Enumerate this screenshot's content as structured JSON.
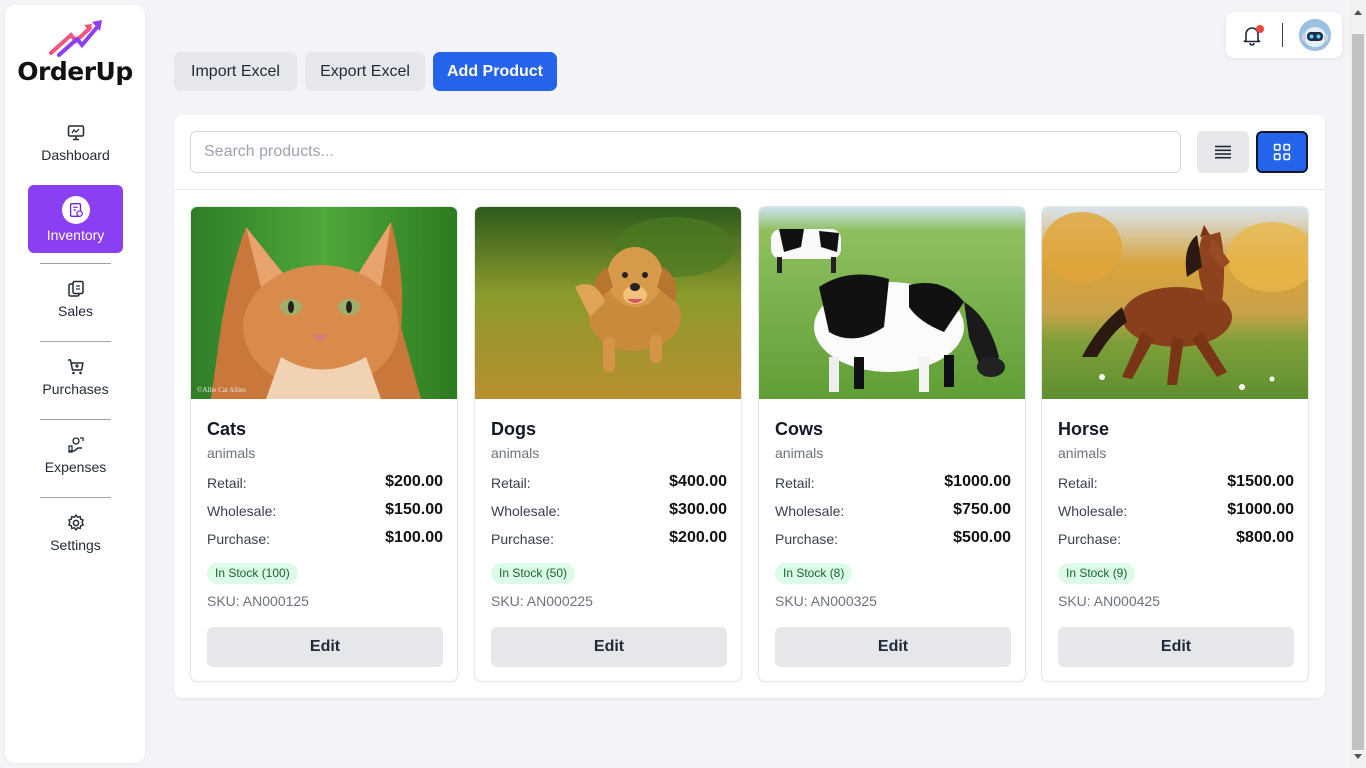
{
  "brand": {
    "name": "OrderUp"
  },
  "sidebar": {
    "items": [
      {
        "label": "Dashboard",
        "icon": "monitor-icon"
      },
      {
        "label": "Inventory",
        "icon": "inventory-icon",
        "active": true
      },
      {
        "label": "Sales",
        "icon": "sales-icon"
      },
      {
        "label": "Purchases",
        "icon": "cart-icon"
      },
      {
        "label": "Expenses",
        "icon": "expenses-icon"
      },
      {
        "label": "Settings",
        "icon": "gear-icon"
      }
    ]
  },
  "header": {
    "notification_icon": "bell-icon",
    "avatar_icon": "robot-avatar"
  },
  "toolbar": {
    "import_label": "Import Excel",
    "export_label": "Export Excel",
    "add_label": "Add Product"
  },
  "search": {
    "placeholder": "Search products...",
    "value": ""
  },
  "view_toggle": {
    "list_icon": "list-icon",
    "grid_icon": "grid-icon",
    "active": "grid"
  },
  "labels": {
    "retail": "Retail:",
    "wholesale": "Wholesale:",
    "purchase": "Purchase:",
    "edit": "Edit"
  },
  "products": [
    {
      "name": "Cats",
      "category": "animals",
      "retail": "$200.00",
      "wholesale": "$150.00",
      "purchase": "$100.00",
      "stock": "In Stock (100)",
      "sku": "SKU: AN000125",
      "watermark": "©Allie Cat Allies"
    },
    {
      "name": "Dogs",
      "category": "animals",
      "retail": "$400.00",
      "wholesale": "$300.00",
      "purchase": "$200.00",
      "stock": "In Stock (50)",
      "sku": "SKU: AN000225"
    },
    {
      "name": "Cows",
      "category": "animals",
      "retail": "$1000.00",
      "wholesale": "$750.00",
      "purchase": "$500.00",
      "stock": "In Stock (8)",
      "sku": "SKU: AN000325"
    },
    {
      "name": "Horse",
      "category": "animals",
      "retail": "$1500.00",
      "wholesale": "$1000.00",
      "purchase": "$800.00",
      "stock": "In Stock (9)",
      "sku": "SKU: AN000425"
    }
  ],
  "colors": {
    "accent": "#2563eb",
    "nav_active": "#8b3ff2",
    "stock_bg": "#dcfce7",
    "stock_text": "#166534"
  }
}
